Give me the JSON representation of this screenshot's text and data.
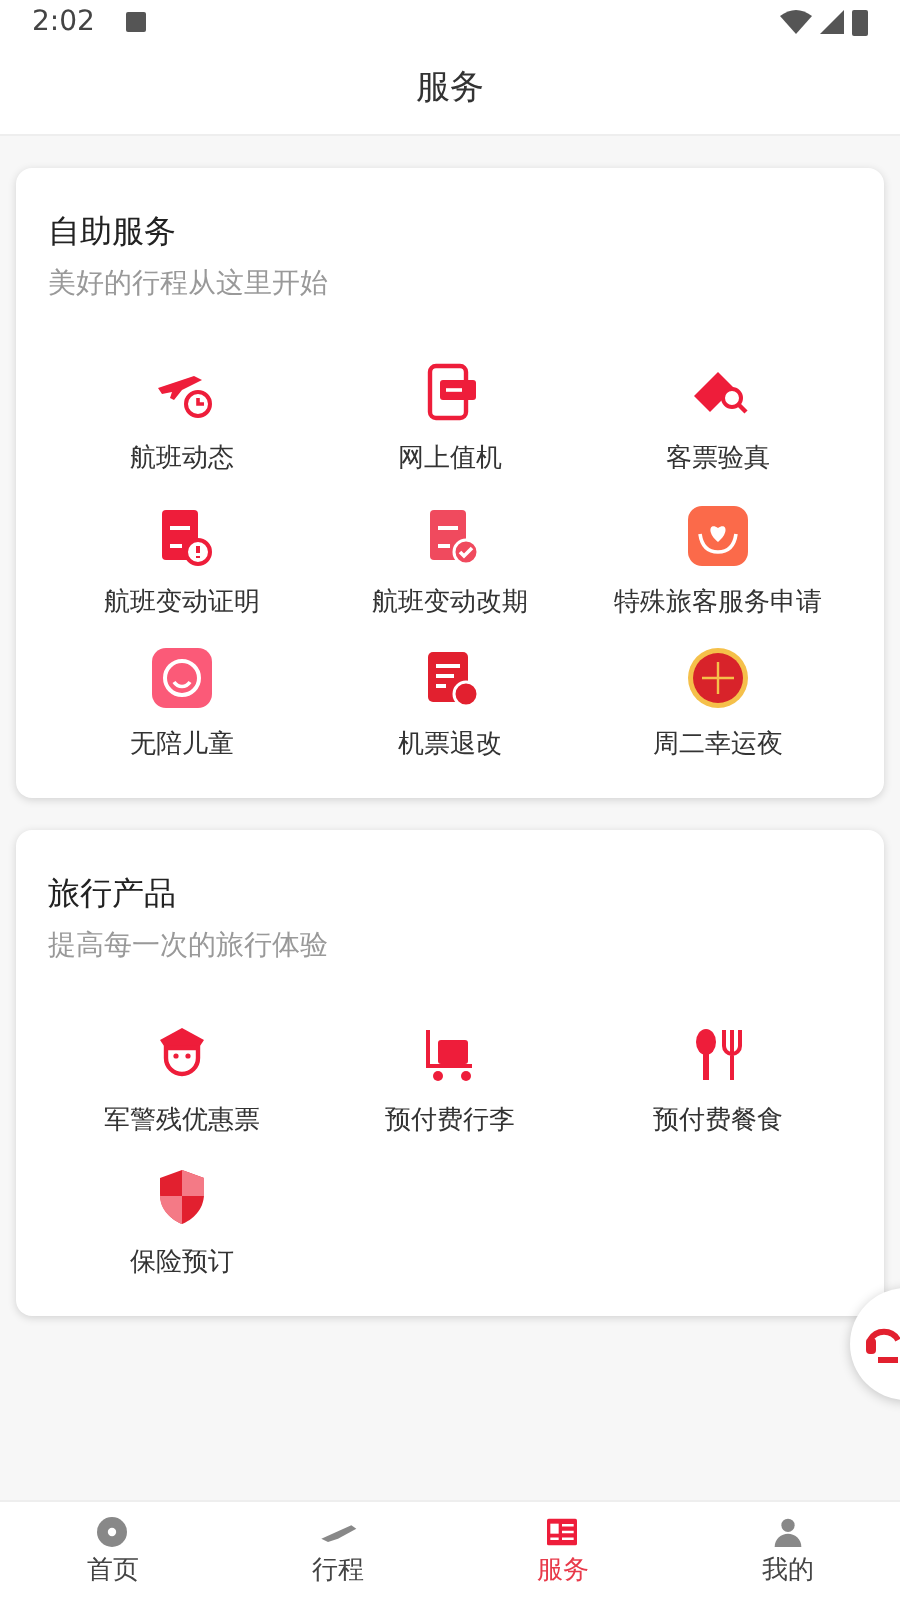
{
  "status_bar": {
    "time": "2:02"
  },
  "header": {
    "title": "服务"
  },
  "sections": [
    {
      "title": "自助服务",
      "subtitle": "美好的行程从这里开始",
      "items": [
        {
          "label": "航班动态"
        },
        {
          "label": "网上值机"
        },
        {
          "label": "客票验真"
        },
        {
          "label": "航班变动证明"
        },
        {
          "label": "航班变动改期"
        },
        {
          "label": "特殊旅客服务申请"
        },
        {
          "label": "无陪儿童"
        },
        {
          "label": "机票退改"
        },
        {
          "label": "周二幸运夜"
        }
      ]
    },
    {
      "title": "旅行产品",
      "subtitle": "提高每一次的旅行体验",
      "items": [
        {
          "label": "军警残优惠票"
        },
        {
          "label": "预付费行李"
        },
        {
          "label": "预付费餐食"
        },
        {
          "label": "保险预订"
        }
      ]
    }
  ],
  "tab_bar": [
    {
      "label": "首页",
      "selected": false
    },
    {
      "label": "行程",
      "selected": false
    },
    {
      "label": "服务",
      "selected": true
    },
    {
      "label": "我的",
      "selected": false
    }
  ]
}
